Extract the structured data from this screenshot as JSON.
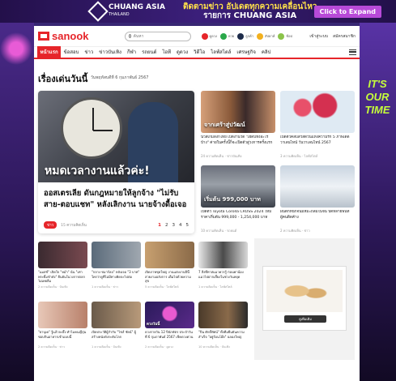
{
  "top_ad": {
    "brand": "CHUANG ASIA",
    "brand_sub": "THAILAND",
    "line1": "ติดตามข่าว อัปเดตทุกความเคลื่อนไหว",
    "line2": "รายการ CHUANG ASIA",
    "cta": "Click to Expand"
  },
  "side_ad": {
    "slogan": "IT'S OUR TIME"
  },
  "header": {
    "logo": "sanook",
    "search_placeholder": "ค้นหา",
    "icons": [
      "ดูดวง",
      "หวย",
      "ลูกค้า",
      "สัปดาห์",
      "ช้อป"
    ],
    "right": [
      "เข้าสู่ระบบ",
      "สมัครสมาชิก"
    ]
  },
  "nav": [
    "หน้าแรก",
    "ข้อสอบ",
    "ข่าว",
    "ข่าวบันเทิง",
    "กีฬา",
    "รถยนต์",
    "ไอที",
    "ดูดวง",
    "วิดีโอ",
    "ไลฟ์สไตล์",
    "เศรษฐกิจ",
    "คลิป"
  ],
  "section": {
    "title": "เรื่องเด่นวันนี้",
    "date": "วันพฤหัสบดีที่ 6 กุมภาพันธ์ 2567"
  },
  "hero": {
    "overlay": "หมดเวลางานแล้วค่ะ!",
    "title": "ออสเตรเลีย ดันกฎหมายให้ลูกจ้าง \"ไม่รับสาย-ตอบแชท\" หลังเลิกงาน นายจ้างดื้อเจอ",
    "tag": "ข่าว",
    "meta": "15 ความคิดเห็น",
    "pages": [
      "1",
      "2",
      "3",
      "4",
      "5"
    ]
  },
  "cards": [
    {
      "caption": "จากเศร้าสู่ปวัฒน์",
      "title": "นิวส์เกมลิงก์ไทย เปิดงานวัด \"เฮดบีทังอะไรบ้าง\" ค่ายในครั้งนี้ก็จะเปิดตัวสู่วงการครั้งแรก",
      "meta": "24 ความคิดเห็น · ข่าวบันเทิง"
    },
    {
      "caption": "",
      "title": "เปิดตัวคลิปสวัสดีวันแห่งความรัก 5 ภาพเด็ดวาเลนไทน์ วันวาเลนไทน์ 2567",
      "meta": "3 ความคิดเห็น · ไลฟ์สไตล์"
    },
    {
      "caption": "เริ่มต้น 999,000 บาท",
      "title": "เปิดตัว Toyota Corolla CROSS 2024 ใหม่ ราคาเริ่มต้น 999,000 - 1,254,000 บาท",
      "meta": "10 ความคิดเห็น · รถยนต์"
    },
    {
      "caption": "",
      "title": "ฝนตกหนักจนมีหิมะถล่มในจีน ปิดหลายพื้นที่ ผู้คนติดค้าง",
      "meta": "2 ความคิดเห็น · ข่าว"
    }
  ],
  "grid": [
    {
      "caption": "",
      "title": "\"แมสช์\" เปิดใจ \"หม่ำ\" นั่น \"เท่าพระยิ้มขำดัง\" ยืนยันในวงการตลกไม่เคยลืม",
      "meta": "2 ความคิดเห็น · บันเทิง"
    },
    {
      "caption": "",
      "title": "\"กลาง ชมาร์ลอ\" หลังเจอ \"3 บาท\" ใครว่าดูที่ไม่มีทางคิดจะไปต่อ",
      "meta": "1 ความคิดเห็น · ข่าว"
    },
    {
      "caption": "",
      "title": "เปิดภาพชุดใหญ่ งานแต่งงานปีนี้ สวยงามอลังการ เต็มไปด้วยความสุข",
      "meta": "5 ความคิดเห็น · ไลฟ์สไตล์"
    },
    {
      "caption": "",
      "title": "7 สิ่งที่ทาสแมวควรรู้ ก่อนพาน้องแมวไปฝากเลี้ยงในช่วงวันหยุด",
      "meta": "1 ความคิดเห็น · ไลฟ์สไตล์"
    },
    {
      "caption": "",
      "title": "\"ยาบุเค\" รู้แล้วจะอึ้ง ทำไมคนญี่ปุ่นชอบกินอาหารเช้าแบบนี้",
      "meta": "2 ความคิดเห็น · ข่าว"
    },
    {
      "caption": "",
      "title": "เปิดประวัติผู้กำกับ \"ไชส์ ชัยน์\" ผู้สร้างหนังดังระดับโลก",
      "meta": "1 ความคิดเห็น · บันเทิง"
    },
    {
      "caption": "ดวงวันนี้",
      "title": "ดวงรายวัน 12 ปีนักษัตร ประจำวันที่ 6 กุมภาพันธ์ 2567 เช็คดวงด่วน",
      "meta": "2 ความคิดเห็น · ดูดวง"
    },
    {
      "caption": "",
      "title": "\"ปิ่น ศักดิ์ทัศน์\" ทั้งทีมยืนยันความสำเร็จ \"อยู่ร้อนโอ๊ย\" ฉลองใหญ่",
      "meta": "10 ความคิดเห็น · บันเทิง"
    }
  ],
  "adbox": {
    "button": "ดูเพิ่มเติม"
  },
  "colors": {
    "brand": "#e6252a"
  }
}
